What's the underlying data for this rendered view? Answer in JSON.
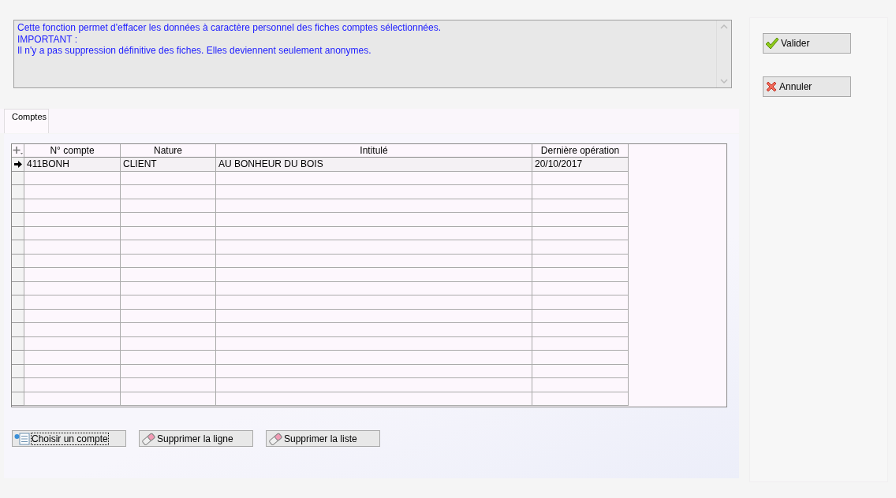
{
  "info_box": {
    "lines": [
      "Cette fonction permet d'effacer les données à caractère personnel des fiches comptes sélectionnées.",
      "IMPORTANT :",
      "Il n'y a pas suppression définitive des fiches. Elles deviennent seulement anonymes."
    ]
  },
  "tabs": [
    {
      "label": "Comptes",
      "selected": true
    }
  ],
  "table": {
    "columns": [
      "N° compte",
      "Nature",
      "Intitulé",
      "Dernière opération"
    ],
    "rows": [
      {
        "selected": true,
        "cells": [
          "411BONH",
          "CLIENT",
          "AU BONHEUR DU BOIS",
          "20/10/2017"
        ]
      }
    ]
  },
  "list_buttons": [
    {
      "kind": "choose",
      "label": "Choisir un compte"
    },
    {
      "kind": "erase",
      "label": "Supprimer la ligne"
    },
    {
      "kind": "erase",
      "label": "Supprimer la liste"
    }
  ],
  "actions": [
    {
      "kind": "ok",
      "label": "Valider"
    },
    {
      "kind": "cancel",
      "label": "Annuler"
    }
  ]
}
